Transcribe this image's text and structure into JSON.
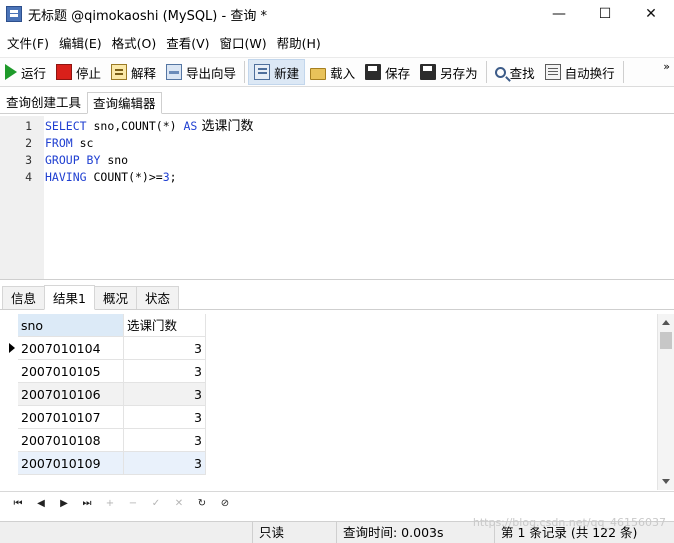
{
  "window": {
    "title": "无标题 @qimokaoshi (MySQL) - 查询 *",
    "minimize": "—",
    "maximize": "☐",
    "close": "✕"
  },
  "menu": [
    "文件(F)",
    "编辑(E)",
    "格式(O)",
    "查看(V)",
    "窗口(W)",
    "帮助(H)"
  ],
  "toolbar": {
    "run": "运行",
    "stop": "停止",
    "explain": "解释",
    "export": "导出向导",
    "new": "新建",
    "load": "载入",
    "save": "保存",
    "save_as": "另存为",
    "find": "查找",
    "word_wrap": "自动换行",
    "more": "»"
  },
  "editor_tabs": [
    "查询创建工具",
    "查询编辑器"
  ],
  "editor": {
    "lines": [
      {
        "n": "1",
        "kw": "SELECT",
        "rest": " sno,COUNT(*) ",
        "kw2": "AS",
        "cjk": " 选课门数"
      },
      {
        "n": "2",
        "kw": "FROM",
        "rest": " sc"
      },
      {
        "n": "3",
        "kw": "GROUP BY",
        "rest": " sno"
      },
      {
        "n": "4",
        "kw": "HAVING",
        "rest": " COUNT(*)>=",
        "num": "3",
        "tail": ";"
      }
    ]
  },
  "result_tabs": [
    "信息",
    "结果1",
    "概况",
    "状态"
  ],
  "table": {
    "columns": [
      "sno",
      "选课门数"
    ],
    "rows": [
      [
        "2007010104",
        "3"
      ],
      [
        "2007010105",
        "3"
      ],
      [
        "2007010106",
        "3"
      ],
      [
        "2007010107",
        "3"
      ],
      [
        "2007010108",
        "3"
      ],
      [
        "2007010109",
        "3"
      ]
    ]
  },
  "navigation": {
    "first": "⏮",
    "prev": "◀",
    "next": "▶",
    "last": "⏭",
    "add": "+",
    "delete": "−",
    "apply": "✓",
    "cancel": "✕",
    "refresh": "↻",
    "stop": "⊘"
  },
  "status": {
    "readonly": "只读",
    "query_time": "查询时间: 0.003s",
    "records": "第 1 条记录 (共 122 条)"
  },
  "watermark": "https://blog.csdn.net/qq_46156037"
}
